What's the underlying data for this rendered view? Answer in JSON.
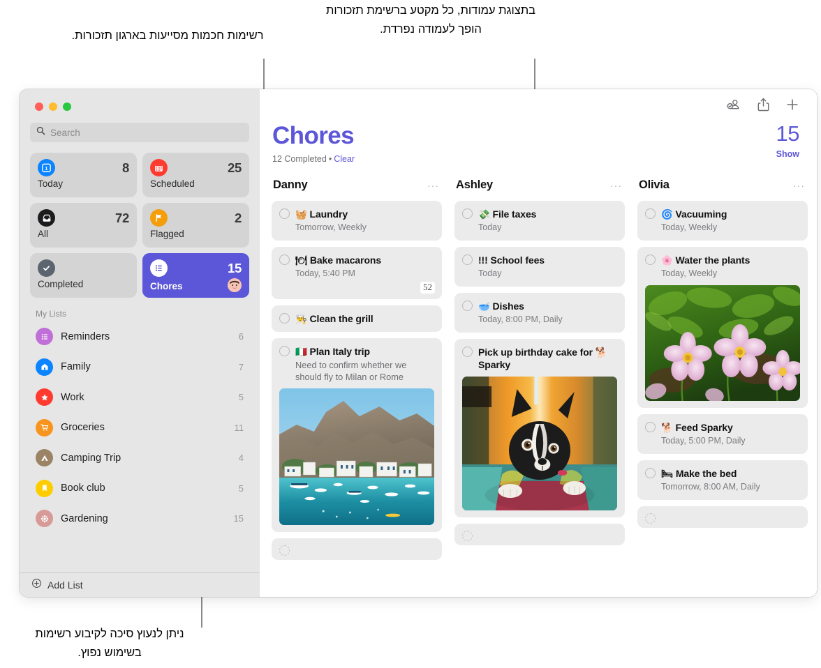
{
  "annotations": {
    "top_right": "בתצוגת עמודות, כל מקטע ברשימת תזכורות הופך לעמודה נפרדת.",
    "top_left": "רשימות חכמות מסייעות בארגון תזכורות.",
    "bottom": "ניתן לנעוץ סיכה לקיבוע רשימות בשימוש נפוץ."
  },
  "window": {
    "traffic_lights": [
      "close",
      "minimize",
      "zoom"
    ]
  },
  "sidebar": {
    "search": {
      "placeholder": "Search",
      "value": "",
      "icon": "search-icon"
    },
    "smart_lists": [
      {
        "label": "Today",
        "count": "8",
        "icon": "today-calendar-icon",
        "color": "#0a84ff",
        "glyph": "1",
        "selected": false
      },
      {
        "label": "Scheduled",
        "count": "25",
        "icon": "calendar-icon",
        "color": "#ff3b30",
        "glyph": "▦",
        "selected": false
      },
      {
        "label": "All",
        "count": "72",
        "icon": "inbox-tray-icon",
        "color": "#1c1c1e",
        "glyph": "▼",
        "selected": false
      },
      {
        "label": "Flagged",
        "count": "2",
        "icon": "flag-icon",
        "color": "#f59e0b",
        "glyph": "⚑",
        "selected": false
      },
      {
        "label": "Completed",
        "count": "",
        "icon": "checkmark-circle-icon",
        "color": "#5b6570",
        "glyph": "✓",
        "selected": false
      },
      {
        "label": "Chores",
        "count": "15",
        "icon": "list-bullet-icon",
        "color": "#ffffff",
        "glyph": "☰",
        "selected": true,
        "avatar": "shared-avatar"
      }
    ],
    "my_lists_header": "My Lists",
    "lists": [
      {
        "label": "Reminders",
        "count": "6",
        "icon": "list-bullet-icon",
        "color": "#c06fd8"
      },
      {
        "label": "Family",
        "count": "7",
        "icon": "house-icon",
        "color": "#0a84ff"
      },
      {
        "label": "Work",
        "count": "5",
        "icon": "star-icon",
        "color": "#ff3b30"
      },
      {
        "label": "Groceries",
        "count": "11",
        "icon": "shopping-cart-icon",
        "color": "#f7941d"
      },
      {
        "label": "Camping Trip",
        "count": "4",
        "icon": "tent-icon",
        "color": "#9b8466"
      },
      {
        "label": "Book club",
        "count": "5",
        "icon": "bookmark-icon",
        "color": "#ffcc00"
      },
      {
        "label": "Gardening",
        "count": "15",
        "icon": "flower-icon",
        "color": "#d79a96"
      }
    ],
    "add_list": {
      "label": "Add List",
      "icon": "plus-circle-icon"
    }
  },
  "main": {
    "toolbar": [
      {
        "name": "shared-list-icon",
        "label": "Shared list"
      },
      {
        "name": "share-icon",
        "label": "Share"
      },
      {
        "name": "add-reminder-icon",
        "label": "Add reminder"
      }
    ],
    "title": "Chores",
    "completed_text": "12 Completed",
    "separator": "•",
    "clear_label": "Clear",
    "total_count": "15",
    "show_label": "Show",
    "columns": [
      {
        "name": "Danny",
        "more": "···",
        "items": [
          {
            "emoji": "🧺",
            "title": "Laundry",
            "sub": "Tomorrow, Weekly"
          },
          {
            "emoji": "🍽",
            "title": "Bake macarons",
            "sub": "Today, 5:40 PM",
            "badge": "52"
          },
          {
            "emoji": "👨‍🍳",
            "title": "Clean the grill",
            "sub": ""
          },
          {
            "emoji": "🇮🇹",
            "title": "Plan Italy trip",
            "note": "Need to confirm whether we should fly to Milan or Rome",
            "photo": "italy-coast-photo"
          },
          {
            "emoji": "",
            "title": "",
            "sub": "",
            "empty": true
          }
        ]
      },
      {
        "name": "Ashley",
        "more": "···",
        "items": [
          {
            "emoji": "💸",
            "title": "File taxes",
            "sub": "Today"
          },
          {
            "emoji": "",
            "title": "!!! School fees",
            "sub": "Today"
          },
          {
            "emoji": "🥣",
            "title": "Dishes",
            "sub": "Today, 8:00 PM, Daily"
          },
          {
            "emoji": "🐕",
            "title": "Pick up birthday cake for 🐕 Sparky",
            "photo": "dog-photo"
          },
          {
            "emoji": "",
            "title": "",
            "sub": "",
            "empty": true
          }
        ]
      },
      {
        "name": "Olivia",
        "more": "···",
        "items": [
          {
            "emoji": "🌀",
            "title": "Vacuuming",
            "sub": "Today, Weekly"
          },
          {
            "emoji": "🌸",
            "title": "Water the plants",
            "sub": "Today, Weekly",
            "photo": "flowers-photo"
          },
          {
            "emoji": "🐕",
            "title": "Feed Sparky",
            "sub": "Today, 5:00 PM, Daily"
          },
          {
            "emoji": "🛏",
            "title": "Make the bed",
            "sub": "Tomorrow, 8:00 AM, Daily"
          },
          {
            "emoji": "",
            "title": "",
            "sub": "",
            "empty": true
          }
        ]
      }
    ]
  },
  "colors": {
    "accent": "#5c57d8",
    "sidebar_bg": "#e6e6e6",
    "card_bg": "#ebebeb"
  }
}
